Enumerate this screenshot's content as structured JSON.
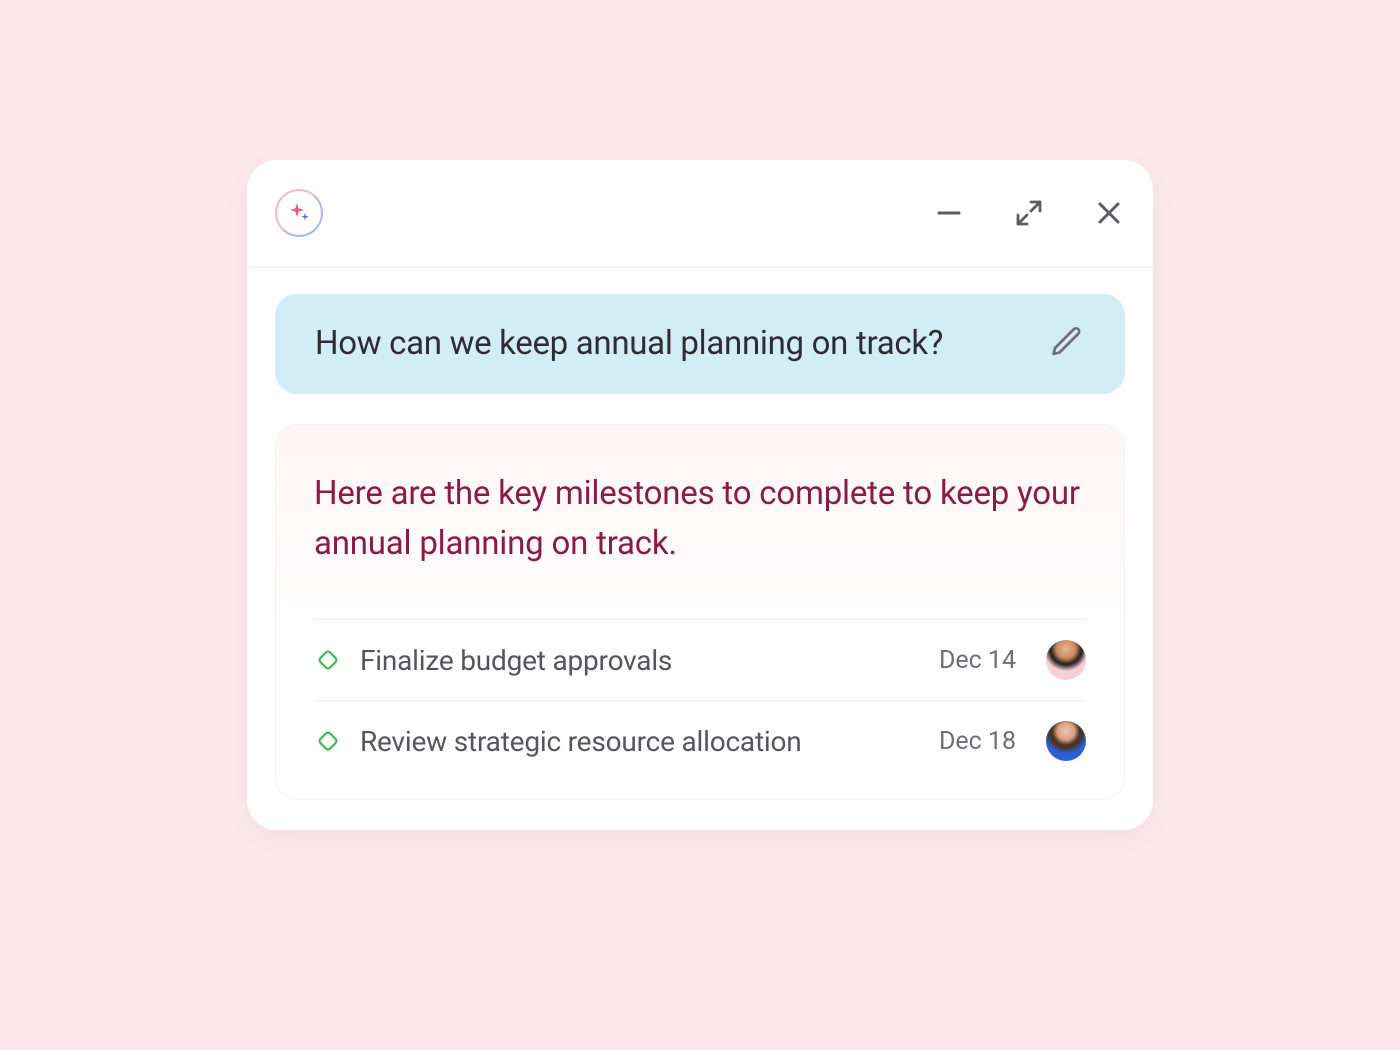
{
  "prompt": {
    "text": "How can we keep annual planning on track?"
  },
  "answer": {
    "intro": "Here are the key milestones to complete to keep your annual planning on track."
  },
  "milestones": [
    {
      "title": "Finalize budget approvals",
      "date": "Dec 14"
    },
    {
      "title": "Review strategic resource allocation",
      "date": "Dec 18"
    }
  ]
}
